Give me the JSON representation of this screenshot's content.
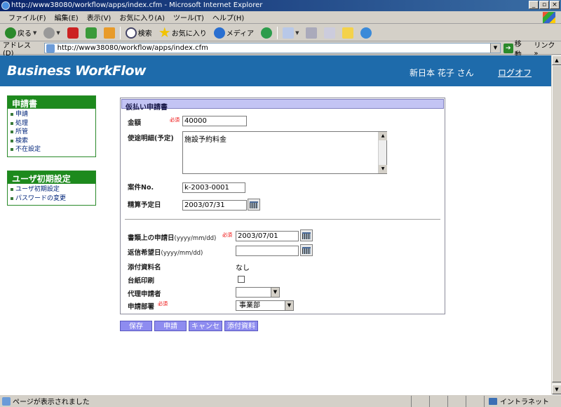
{
  "window": {
    "title": "http://www38080/workflow/apps/index.cfm - Microsoft Internet Explorer",
    "controls": [
      "_",
      "▫",
      "×"
    ]
  },
  "menubar": [
    "ファイル(F)",
    "編集(E)",
    "表示(V)",
    "お気に入り(A)",
    "ツール(T)",
    "ヘルプ(H)"
  ],
  "toolbar": {
    "back": "戻る",
    "search": "検索",
    "favorites": "お気に入り",
    "media": "メディア"
  },
  "address": {
    "label": "アドレス(D)",
    "url": "http://www38080/workflow/apps/index.cfm",
    "go": "移動",
    "links": "リンク »"
  },
  "header": {
    "brand": "Business WorkFlow",
    "user": "新日本 花子 さん",
    "logout": "ログオフ"
  },
  "sidebar": {
    "groups": [
      {
        "title": "申請書",
        "items": [
          "申請",
          "処理",
          "所管",
          "検索",
          "不在設定"
        ]
      },
      {
        "title": "ユーザ初期設定",
        "items": [
          "ユーザ初期設定",
          "パスワードの変更"
        ]
      }
    ]
  },
  "form": {
    "title": "仮払い申請書",
    "required_mark": "必須",
    "amount": {
      "label": "金額",
      "value": "40000"
    },
    "purpose": {
      "label": "使途明細(予定)",
      "value": "施設予約料金"
    },
    "case_no": {
      "label": "案件No.",
      "value": "k-2003-0001"
    },
    "settlement_date": {
      "label": "精算予定日",
      "value": "2003/07/31"
    },
    "doc_date": {
      "label": "書類上の申請日",
      "format": "(yyyy/mm/dd)",
      "value": "2003/07/01"
    },
    "reply_date": {
      "label": "返信希望日",
      "format": "(yyyy/mm/dd)",
      "value": ""
    },
    "attachment": {
      "label": "添付資料名",
      "value": "なし"
    },
    "ledger_print": {
      "label": "台紙印刷",
      "checked": false
    },
    "proxy": {
      "label": "代理申請者",
      "value": ""
    },
    "department": {
      "label": "申請部署",
      "value": "事業部"
    }
  },
  "actions": {
    "save": "保存",
    "apply": "申請",
    "cancel": "キャンセル",
    "attach": "添付資料"
  },
  "status": {
    "message": "ページが表示されました",
    "zone": "イントラネット"
  }
}
